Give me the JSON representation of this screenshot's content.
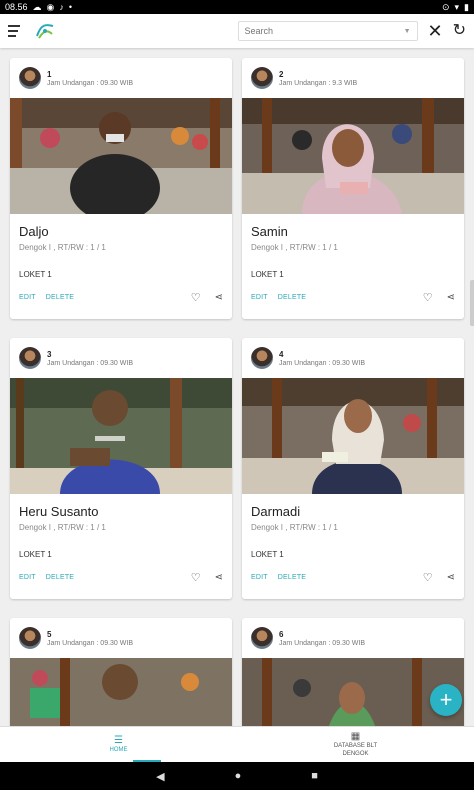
{
  "status": {
    "time": "08.56",
    "icons_left": [
      "notification-icon",
      "whatsapp-icon",
      "tiktok-icon",
      "dot-icon"
    ],
    "icons_right": [
      "location-icon",
      "wifi-icon",
      "battery-icon"
    ]
  },
  "appbar": {
    "search_placeholder": "Search"
  },
  "cards": [
    {
      "number": "1",
      "jam": "Jam Undangan : 09.30 WIB",
      "name": "Daljo",
      "addr": "Dengok I , RT/RW : 1 / 1",
      "loket": "LOKET 1",
      "edit": "EDIT",
      "delete": "DELETE"
    },
    {
      "number": "2",
      "jam": "Jam Undangan : 9.3 WIB",
      "name": "Samin",
      "addr": "Dengok I , RT/RW : 1 / 1",
      "loket": "LOKET 1",
      "edit": "EDIT",
      "delete": "DELETE"
    },
    {
      "number": "3",
      "jam": "Jam Undangan : 09.30 WIB",
      "name": "Heru Susanto",
      "addr": "Dengok I , RT/RW : 1 / 1",
      "loket": "LOKET 1",
      "edit": "EDIT",
      "delete": "DELETE"
    },
    {
      "number": "4",
      "jam": "Jam Undangan : 09.30 WIB",
      "name": "Darmadi",
      "addr": "Dengok I , RT/RW : 1 / 1",
      "loket": "LOKET 1",
      "edit": "EDIT",
      "delete": "DELETE"
    },
    {
      "number": "5",
      "jam": "Jam Undangan : 09.30 WIB"
    },
    {
      "number": "6",
      "jam": "Jam Undangan : 09.30 WIB"
    }
  ],
  "fab": {
    "label": "+"
  },
  "bottom_nav": {
    "home": "HOME",
    "database_line1": "DATABASE BLT",
    "database_line2": "DENGOK"
  },
  "colors": {
    "accent": "#2aa9b8",
    "fab": "#2ab3c4"
  }
}
